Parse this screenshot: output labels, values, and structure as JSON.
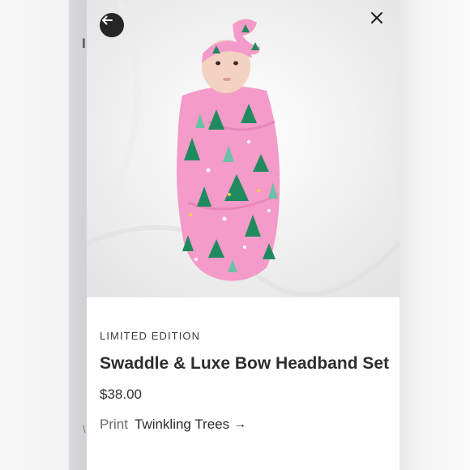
{
  "modal": {
    "product_image_alt": "Baby in pink swaddle with tree print and matching bow headband",
    "edition_label": "LIMITED EDITION",
    "title": "Swaddle & Luxe Bow Headband Set",
    "price": "$38.00",
    "print_label": "Print",
    "print_value": "Twinkling Trees",
    "print_arrow": "→"
  },
  "colors": {
    "swaddle_pink": "#f49bc9",
    "tree_green": "#1f8a5e",
    "button_dark": "#262626"
  },
  "icons": {
    "back": "arrow-left-icon",
    "close": "close-icon",
    "print_link": "arrow-right-icon"
  }
}
